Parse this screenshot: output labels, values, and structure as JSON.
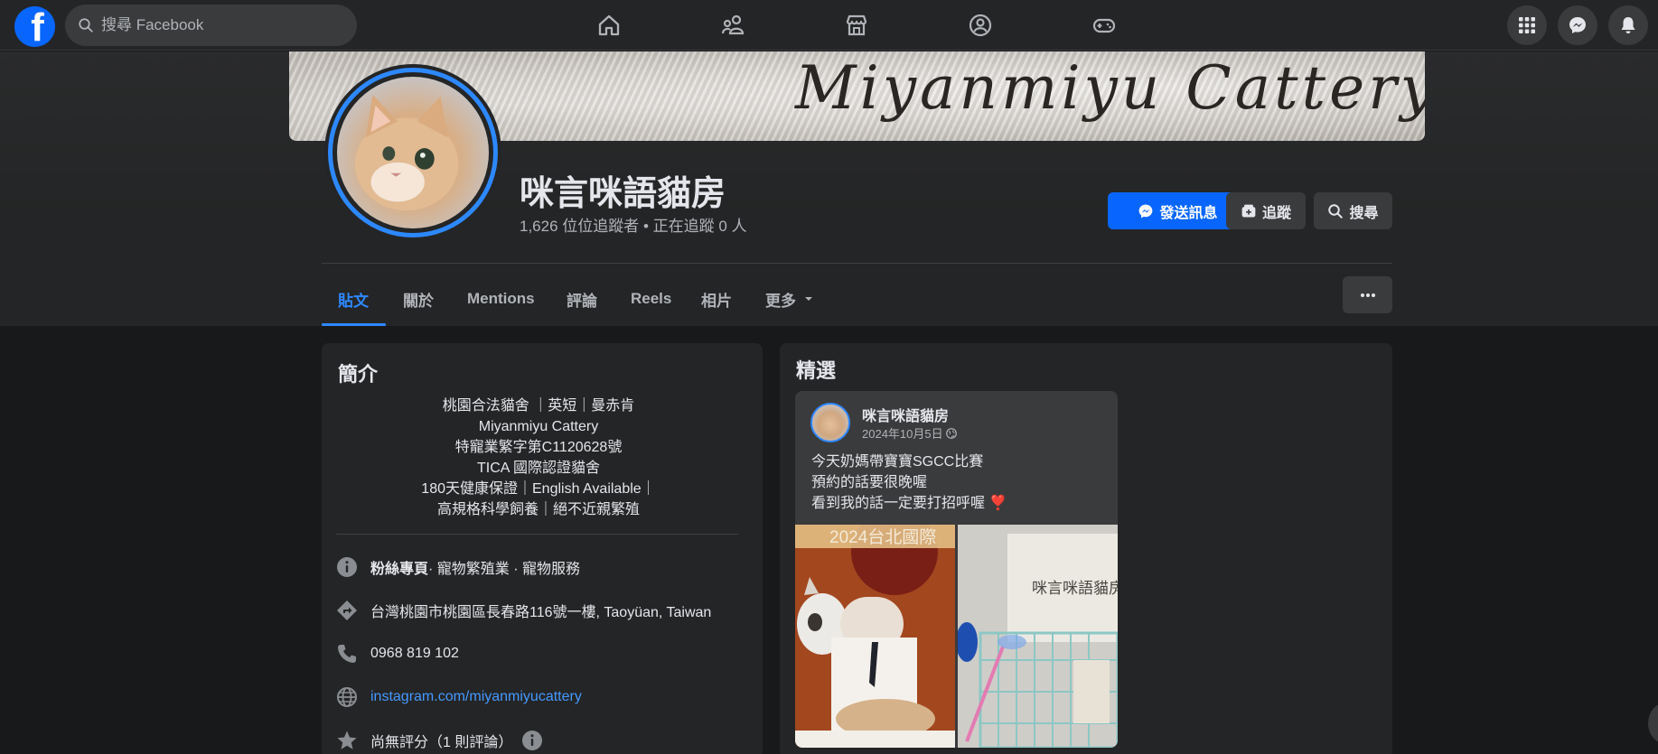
{
  "topbar": {
    "logo_letter": "f",
    "search_placeholder": "搜尋 Facebook"
  },
  "cover": {
    "script_text": "Miyanmiyu  Cattery"
  },
  "profile": {
    "name": "咪言咪語貓房",
    "followers_line": "1,626 位位追蹤者 • 正在追蹤 0 人",
    "buttons": {
      "message": "發送訊息",
      "follow": "追蹤",
      "search": "搜尋"
    }
  },
  "tabs": [
    {
      "label": "貼文"
    },
    {
      "label": "關於"
    },
    {
      "label": "Mentions"
    },
    {
      "label": "評論"
    },
    {
      "label": "Reels"
    },
    {
      "label": "相片"
    },
    {
      "label": "更多"
    }
  ],
  "intro": {
    "title": "簡介",
    "bio_lines": [
      "桃園合法貓舍 ｜英短｜曼赤肯",
      "Miyanmiyu Cattery",
      "特寵業繁字第C1120628號",
      "TICA 國際認證貓舍",
      "180天健康保證｜English Available｜",
      "高規格科學飼養｜絕不近親繁殖"
    ],
    "category_bold": "粉絲專頁",
    "category_rest": " · 寵物繁殖業 · 寵物服務",
    "address": "台灣桃園市桃園區長春路116號一樓, Taoyüan, Taiwan",
    "phone": "0968 819 102",
    "website": "instagram.com/miyanmiyucattery",
    "rating": "尚無評分（1 則評論）"
  },
  "featured": {
    "title": "精選",
    "post": {
      "author": "咪言咪語貓房",
      "date": "2024年10月5日",
      "lines": [
        "今天奶媽帶寶寶SGCC比賽",
        "預約的話要很晚喔",
        "看到我的話一定要打招呼喔 ❣️"
      ],
      "photo_left_caption": "2024台北國際",
      "photo_right_caption": "咪言咪語貓房"
    }
  },
  "colors": {
    "accent": "#0866ff",
    "active_tab": "#2d88ff",
    "link": "#4599ff",
    "card_bg": "#242526",
    "page_bg": "#18191a"
  }
}
